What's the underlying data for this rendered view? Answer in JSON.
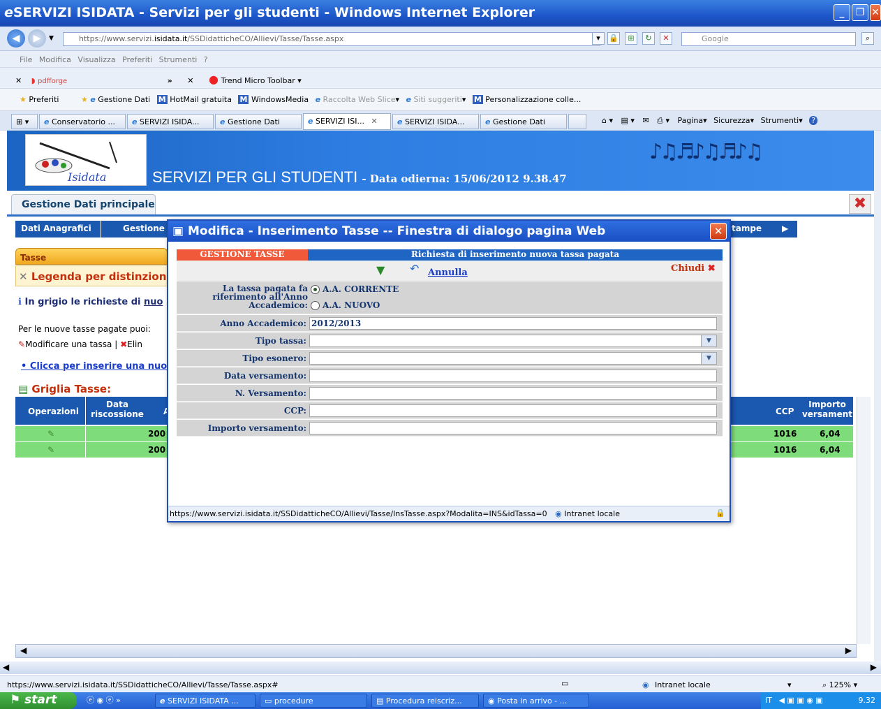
{
  "window": {
    "title": "SERVIZI ISIDATA - Servizi per gli studenti - Windows Internet Explorer"
  },
  "address": {
    "url_prefix": "https://www.servizi.",
    "url_domain": "isidata.it",
    "url_rest": "/SSDidatticheCO/Allievi/Tasse/Tasse.aspx",
    "search_placeholder": "Google"
  },
  "menu": [
    "File",
    "Modifica",
    "Visualizza",
    "Preferiti",
    "Strumenti",
    "?"
  ],
  "toolbar1": {
    "pdfforge": "pdfforge",
    "trend": "Trend Micro Toolbar"
  },
  "favorites": {
    "preferiti": "Preferiti",
    "items": [
      "Gestione Dati",
      "HotMail gratuita",
      "WindowsMedia",
      "Raccolta Web Slice",
      "Siti suggeriti",
      "Personalizzazione colle..."
    ]
  },
  "tabs": [
    "Conservatorio ...",
    "SERVIZI ISIDA...",
    "Gestione Dati",
    "SERVIZI ISI...",
    "SERVIZI ISIDA...",
    "Gestione Dati"
  ],
  "cmdbar": {
    "pagina": "Pagina",
    "sicurezza": "Sicurezza",
    "strumenti": "Strumenti"
  },
  "banner": {
    "logo_text": "Isidata",
    "title": "SERVIZI PER GLI STUDENTI",
    "date": "- Data odierna: 15/06/2012 9.38.47"
  },
  "page": {
    "gestione_principale": "Gestione Dati principale",
    "nav": [
      "Dati Anagrafici",
      "Gestione",
      "tampe"
    ],
    "tasse_tab": "Tasse",
    "legenda": "Legenda per distinzione",
    "grigio": "In grigio le richieste di ",
    "grigio_link": "nuo",
    "nuove": "Per le nuove tasse pagate puoi:",
    "modificare": "Modificare una tassa | ",
    "eliminare": "Elin",
    "clicca": "Clicca per inserire una nuo",
    "griglia": "Griglia Tasse:",
    "columns": {
      "operazioni": "Operazioni",
      "data": "Data riscossione",
      "a": "A",
      "ccp": "CCP",
      "importo": "Importo versament"
    },
    "rows": [
      {
        "anno": "200",
        "ccp": "1016",
        "importo": "6,04"
      },
      {
        "anno": "200",
        "ccp": "1016",
        "importo": "6,04"
      }
    ]
  },
  "dialog": {
    "title": "Modifica - Inserimento Tasse -- Finestra di dialogo pagina Web",
    "head_left": "GESTIONE TASSE",
    "head_right": "Richiesta di inserimento nuova tassa pagata",
    "annulla": "Annulla",
    "chiudi": "Chiudi",
    "riferimento_label": "La tassa pagata fa riferimento all'Anno Accademico:",
    "radio_corrente": "A.A. CORRENTE",
    "radio_nuovo": "A.A. NUOVO",
    "fields": {
      "anno_label": "Anno Accademico:",
      "anno_value": "2012/2013",
      "tipo_tassa": "Tipo tassa:",
      "tipo_esonero": "Tipo esonero:",
      "data_versamento": "Data versamento:",
      "n_versamento": "N. Versamento:",
      "ccp": "CCP:",
      "importo": "Importo versamento:"
    },
    "status_url": "https://www.servizi.isidata.it/SSDidatticheCO/Allievi/Tasse/InsTasse.aspx?Modalita=INS&idTassa=0",
    "status_zone": "Intranet locale"
  },
  "statusbar": {
    "url": "https://www.servizi.isidata.it/SSDidatticheCO/Allievi/Tasse/Tasse.aspx#",
    "zone": "Intranet locale",
    "zoom": "125%"
  },
  "taskbar": {
    "start": "start",
    "items": [
      "SERVIZI ISIDATA ...",
      "procedure",
      "Procedura reiscriz...",
      "Posta in arrivo - ..."
    ],
    "lang": "IT",
    "time": "9.32"
  }
}
